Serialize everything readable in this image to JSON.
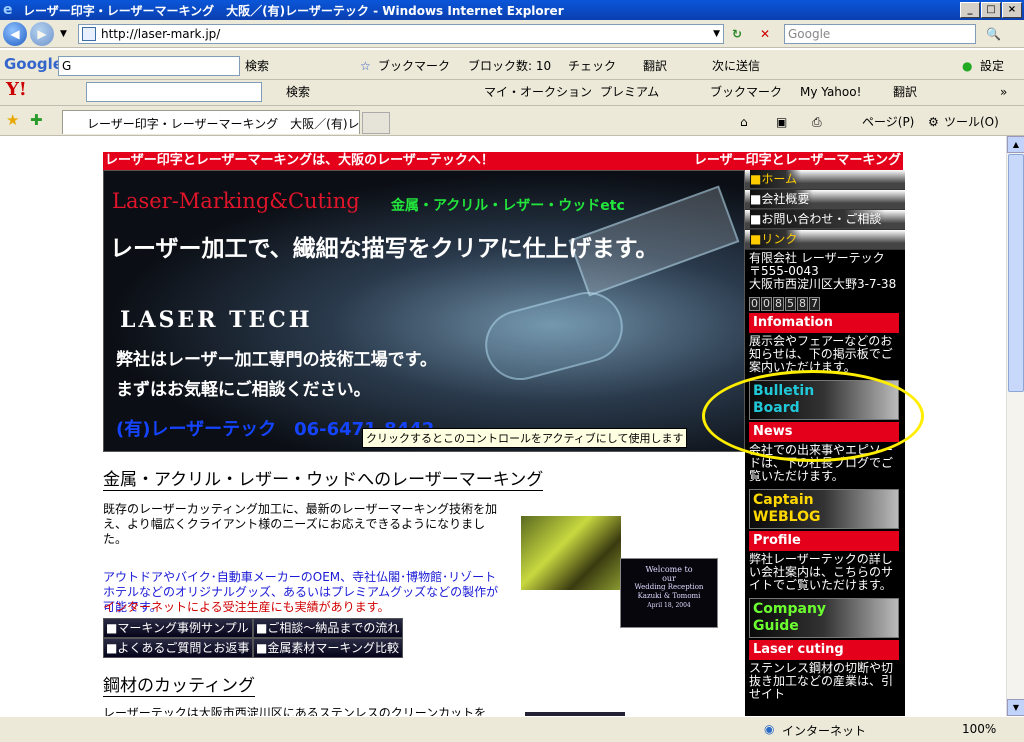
{
  "window": {
    "title": "レーザー印字・レーザーマーキング　大阪／(有)レーザーテック - Windows Internet Explorer",
    "min": "_",
    "max": "□",
    "close": "×"
  },
  "address": {
    "url": "http://laser-mark.jp/",
    "search_placeholder": "Google"
  },
  "google_bar": {
    "logo": "Google",
    "input_value": "G",
    "search": "検索",
    "bookmarks": "ブックマーク",
    "blocked": "ブロック数: 10",
    "check": "チェック",
    "translate": "翻訳",
    "next": "次に送信",
    "settings": "設定"
  },
  "yahoo_bar": {
    "logo": "Y!",
    "search": "検索",
    "my_auction": "マイ・オークション",
    "premium": "プレミアム",
    "bookmarks": "ブックマーク",
    "my_yahoo": "My Yahoo!",
    "translate": "翻訳"
  },
  "tab_bar": {
    "tab_title": "レーザー印字・レーザーマーキング　大阪／(有)レーザー...",
    "page": "ページ(P)",
    "tools": "ツール(O)"
  },
  "page": {
    "header_left": "レーザー印字とレーザーマーキングは、大阪のレーザーテックへ！",
    "header_right": "レーザー印字とレーザーマーキング",
    "banner": {
      "logo_text": "Laser-Marking&Cuting",
      "materials": "金属・アクリル・レザー・ウッドetc",
      "headline": "レーザー加工で、繊細な描写をクリアに仕上げます。",
      "brand": "LASER TECH",
      "line1": "弊社はレーザー加工専門の技術工場です。",
      "line2": "まずはお気軽にご相談ください。",
      "phone": "(有)レーザーテック　06-6471-8442"
    },
    "tooltip": "クリックするとこのコントロールをアクティブにして使用します",
    "section1_title": "金属・アクリル・レザー・ウッドへのレーザーマーキング",
    "section1_text": "既存のレーザーカッティング加工に、最新のレーザーマーキング技術を加え、より幅広くクライアント様のニーズにお応えできるようになりました。",
    "section1_blue": "アウトドアやバイク･自動車メーカーのOEM、寺社仏閣･博物館･リゾートホテルなどのオリジナルグッズ、あるいはプレミアムグッズなどの製作が可能です。",
    "section1_red": "インターネットによる受注生産にも実績があります。",
    "buttons": [
      "■マーキング事例サンプル",
      "■ご相談～納品までの流れ",
      "■よくあるご質問とお返事",
      "■金属素材マーキング比較"
    ],
    "section2_title": "鋼材のカッティング",
    "section2_text": "レーザーテックは大阪市西淀川区にあるステンレスのクリーンカットを",
    "photo_text": [
      "Welcome to",
      "our",
      "Wedding Reception",
      "Kazuki & Tomomi",
      "April 18, 2004"
    ]
  },
  "sidebar": {
    "menu": [
      "■ホーム",
      "■会社概要",
      "■お問い合わせ・ご相談",
      "■リンク"
    ],
    "company": [
      "有限会社 レーザーテック",
      "〒555-0043",
      "大阪市西淀川区大野3-7-38"
    ],
    "counter": [
      "0",
      "0",
      "8",
      "5",
      "8",
      "7"
    ],
    "info_title": "Infomation",
    "info_text": "展示会やフェアーなどのお知らせは、下の掲示板でご案内いただけます。",
    "bulletin": "Bulletin Board",
    "news_title": "News",
    "news_text": "会社での出来事やエピソードは、下の社長ブログでご覧いただけます。",
    "captain": "Captain WEBLOG",
    "profile_title": "Profile",
    "profile_text": "弊社レーザーテックの詳しい会社案内は、こちらのサイトでご覧いただけます。",
    "company_guide": "Company Guide",
    "laser_title": "Laser cuting",
    "laser_text": "ステンレス鋼材の切断や切抜き加工などの産業は、引せイト"
  },
  "status": {
    "zone": "インターネット",
    "zoom": "100%"
  }
}
